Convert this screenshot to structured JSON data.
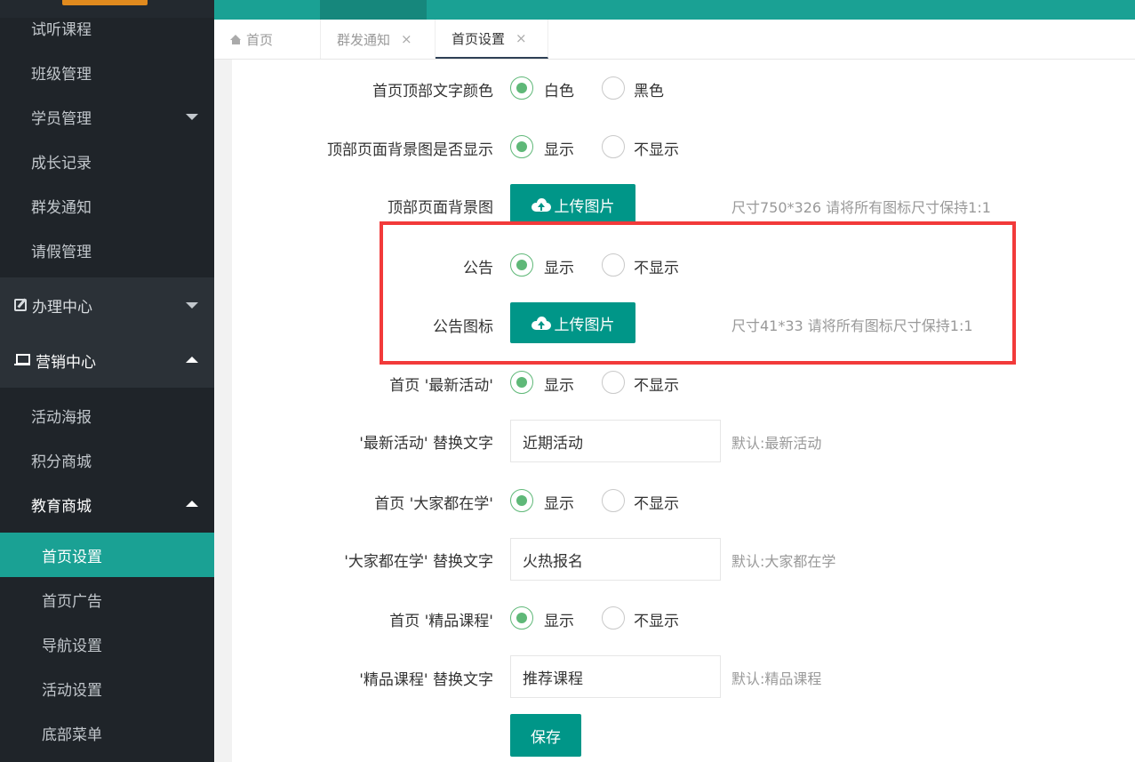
{
  "sidebar": {
    "items": [
      {
        "label": "试听课程"
      },
      {
        "label": "班级管理"
      },
      {
        "label": "学员管理"
      },
      {
        "label": "成长记录"
      },
      {
        "label": "群发通知"
      },
      {
        "label": "请假管理"
      }
    ],
    "group_office": {
      "label": "办理中心",
      "icon": "edit-icon"
    },
    "group_marketing": {
      "label": "营销中心",
      "icon": "laptop-icon"
    },
    "marketing_items": [
      {
        "label": "活动海报"
      },
      {
        "label": "积分商城"
      },
      {
        "label": "教育商城"
      }
    ],
    "shop_items": [
      {
        "label": "首页设置"
      },
      {
        "label": "首页广告"
      },
      {
        "label": "导航设置"
      },
      {
        "label": "活动设置"
      },
      {
        "label": "底部菜单"
      }
    ]
  },
  "tabs": [
    {
      "label": "首页"
    },
    {
      "label": "群发通知"
    },
    {
      "label": "首页设置"
    }
  ],
  "tab_close": "×",
  "form": {
    "top_text_color": {
      "label": "首页顶部文字颜色",
      "option1": "白色",
      "option2": "黑色",
      "selected": "白色"
    },
    "bg_show": {
      "label": "顶部页面背景图是否显示",
      "option1": "显示",
      "option2": "不显示",
      "selected": "显示"
    },
    "bg_image": {
      "label": "顶部页面背景图",
      "button": "上传图片",
      "hint": "尺寸750*326 请将所有图标尺寸保持1:1"
    },
    "notice": {
      "label": "公告",
      "option1": "显示",
      "option2": "不显示",
      "selected": "显示"
    },
    "notice_icon": {
      "label": "公告图标",
      "button": "上传图片",
      "hint": "尺寸41*33 请将所有图标尺寸保持1:1"
    },
    "latest_activity": {
      "label": "首页 '最新活动'",
      "option1": "显示",
      "option2": "不显示",
      "selected": "显示"
    },
    "latest_activity_text": {
      "label": "'最新活动' 替换文字",
      "value": "近期活动",
      "hint": "默认:最新活动"
    },
    "everyone_learning": {
      "label": "首页 '大家都在学'",
      "option1": "显示",
      "option2": "不显示",
      "selected": "显示"
    },
    "everyone_learning_text": {
      "label": "'大家都在学' 替换文字",
      "value": "火热报名",
      "hint": "默认:大家都在学"
    },
    "featured_courses": {
      "label": "首页 '精品课程'",
      "option1": "显示",
      "option2": "不显示",
      "selected": "显示"
    },
    "featured_courses_text": {
      "label": "'精品课程' 替换文字",
      "value": "推荐课程",
      "hint": "默认:精品课程"
    },
    "save": "保存"
  },
  "colors": {
    "accent": "#009688",
    "sidebar": "#1f2429",
    "selected": "#1aa194",
    "radio": "#5fb878",
    "highlight": "#f23a3a"
  }
}
